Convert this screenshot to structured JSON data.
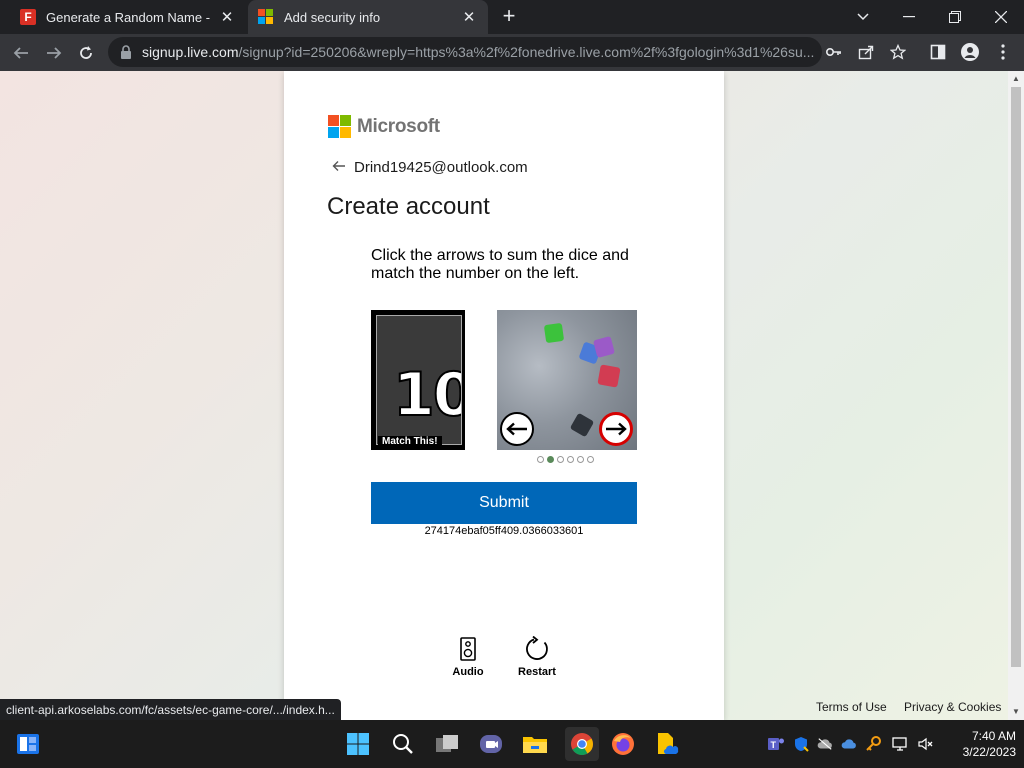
{
  "browser": {
    "tabs": [
      {
        "title": "Generate a Random Name - Fake",
        "active": false,
        "favicon": "fake-name-f-icon"
      },
      {
        "title": "Add security info",
        "active": true,
        "favicon": "microsoft-icon"
      }
    ],
    "address": {
      "host": "signup.live.com",
      "path": "/signup?id=250206&wreply=https%3a%2f%2fonedrive.live.com%2f%3fgologin%3d1%26su..."
    },
    "status_bar_url": "client-api.arkoselabs.com/fc/assets/ec-game-core/.../index.h..."
  },
  "page": {
    "brand": "Microsoft",
    "identity": "Drind19425@outlook.com",
    "title": "Create account",
    "puzzle": {
      "instruction": "Click the arrows to sum the dice and match the number on the left.",
      "target_number": "10",
      "target_caption": "Match This!",
      "image_index": 2,
      "image_count": 6
    },
    "submit_label": "Submit",
    "session_id": "274174ebaf05ff409.0366033601",
    "audio_label": "Audio",
    "restart_label": "Restart",
    "footer": {
      "terms": "Terms of Use",
      "privacy": "Privacy & Cookies"
    }
  },
  "taskbar": {
    "time": "7:40 AM",
    "date": "3/22/2023"
  },
  "colors": {
    "accent_blue": "#0067b8",
    "browser_dark": "#202124",
    "toolbar": "#35363a"
  }
}
